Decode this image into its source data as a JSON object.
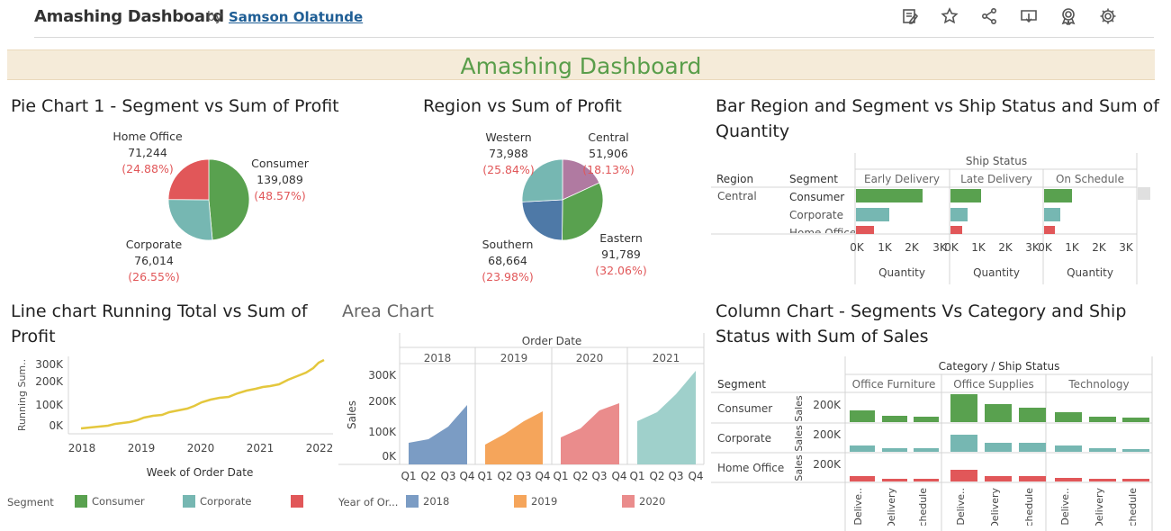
{
  "header": {
    "title": "Amashing Dashboard",
    "by": "by",
    "author": "Samson Olatunde"
  },
  "header_icons": [
    "edit-icon",
    "star-icon",
    "share-icon",
    "download-icon",
    "badge-icon",
    "gear-icon"
  ],
  "banner": {
    "title": "Amashing Dashboard"
  },
  "colors": {
    "consumer": "#59a14f",
    "corporate": "#76b7b2",
    "home_office": "#e15759",
    "purple": "#b07aa1",
    "blue": "#4e79a7",
    "y2018": "#7b9cc4",
    "y2019": "#f5a55b",
    "y2020": "#ea8c8c",
    "y2021": "#9fd0cb",
    "line": "#e4c73d"
  },
  "pie1": {
    "title": "Pie Chart 1 - Segment vs Sum of Profit",
    "slices": [
      {
        "name": "Consumer",
        "value": "139,089",
        "pct": "(48.57%)",
        "share": 48.57,
        "color": "#59a14f"
      },
      {
        "name": "Corporate",
        "value": "76,014",
        "pct": "(26.55%)",
        "share": 26.55,
        "color": "#76b7b2"
      },
      {
        "name": "Home Office",
        "value": "71,244",
        "pct": "(24.88%)",
        "share": 24.88,
        "color": "#e15759"
      }
    ]
  },
  "pie2": {
    "title": "Region vs Sum of Profit",
    "slices": [
      {
        "name": "Central",
        "value": "51,906",
        "pct": "(18.13%)",
        "share": 18.13,
        "color": "#b07aa1"
      },
      {
        "name": "Eastern",
        "value": "91,789",
        "pct": "(32.06%)",
        "share": 32.06,
        "color": "#59a14f"
      },
      {
        "name": "Southern",
        "value": "68,664",
        "pct": "(23.98%)",
        "share": 23.98,
        "color": "#4e79a7"
      },
      {
        "name": "Western",
        "value": "73,988",
        "pct": "(25.84%)",
        "share": 25.84,
        "color": "#76b7b2"
      }
    ]
  },
  "bar": {
    "title_line1": "Bar Region and Segment vs Ship Status and Sum of",
    "title_line2": "Quantity",
    "header": "Ship Status",
    "col_region": "Region",
    "col_segment": "Segment",
    "statuses": [
      "Early Delivery",
      "Late Delivery",
      "On Schedule"
    ],
    "region": "Central",
    "segments": [
      "Consumer",
      "Corporate",
      "Home Office"
    ],
    "ticks": [
      "0K",
      "1K",
      "2K",
      "3K"
    ],
    "axis_label": "Quantity"
  },
  "line": {
    "title_line1": "Line chart Running Total vs Sum of",
    "title_line2": "Profit",
    "ylabel": "Running Sum..",
    "xlabel": "Week of Order Date",
    "yticks": [
      "300K",
      "200K",
      "100K",
      "0K"
    ],
    "xticks": [
      "2018",
      "2019",
      "2020",
      "2021",
      "2022"
    ]
  },
  "area": {
    "title": "Area Chart",
    "header": "Order Date",
    "years": [
      "2018",
      "2019",
      "2020",
      "2021"
    ],
    "quarters": [
      "Q1",
      "Q2",
      "Q3",
      "Q4"
    ],
    "ylabel": "Sales",
    "yticks": [
      "300K",
      "200K",
      "100K",
      "0K"
    ]
  },
  "column": {
    "title_line1": "Column Chart - Segments Vs Category and Ship",
    "title_line2": "Status with Sum of Sales",
    "header": "Category / Ship Status",
    "col_segment": "Segment",
    "categories": [
      "Office Furniture",
      "Office Supplies",
      "Technology"
    ],
    "segments": [
      "Consumer",
      "Corporate",
      "Home Office"
    ],
    "yaxis": "Sales",
    "ytick": "200K",
    "statuses": [
      "Early Delive..",
      "Late Delivery",
      "On Schedule"
    ]
  },
  "legend_segment": {
    "label": "Segment",
    "items": [
      {
        "name": "Consumer",
        "color": "#59a14f"
      },
      {
        "name": "Corporate",
        "color": "#76b7b2"
      },
      {
        "name": "",
        "color": "#e15759"
      }
    ]
  },
  "legend_year": {
    "label": "Year of Or...",
    "items": [
      {
        "name": "2018",
        "color": "#7b9cc4"
      },
      {
        "name": "2019",
        "color": "#f5a55b"
      },
      {
        "name": "2020",
        "color": "#ea8c8c"
      }
    ]
  }
}
